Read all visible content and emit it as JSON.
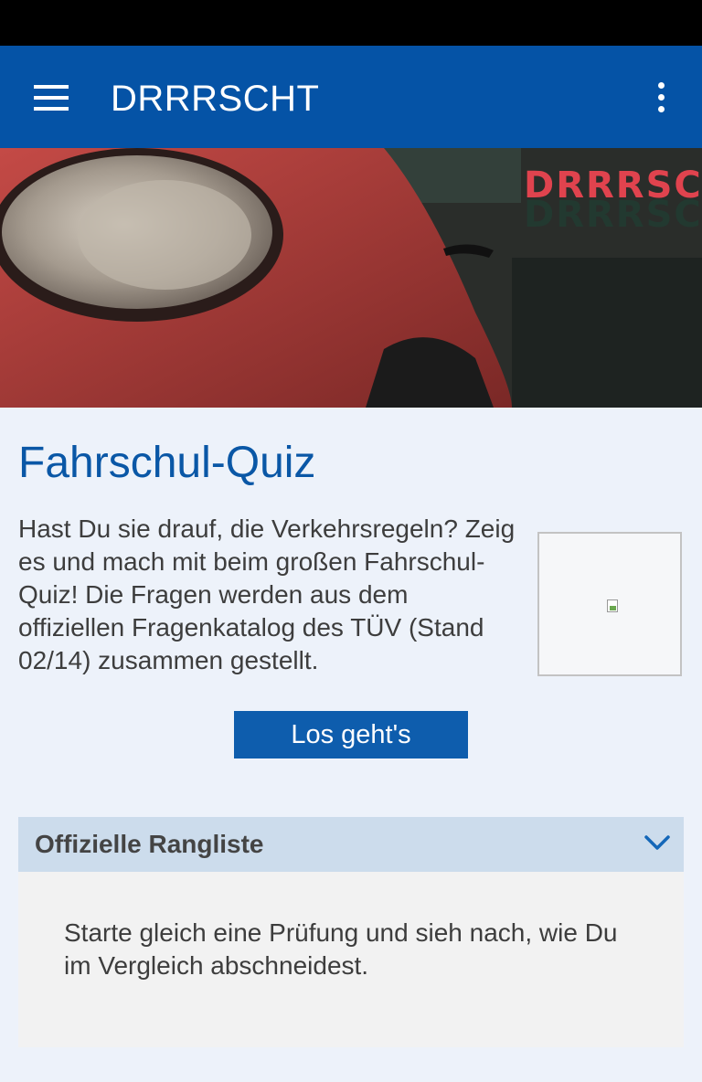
{
  "app_bar": {
    "title": "DRRRSCHT",
    "menu_icon": "hamburger-menu-icon",
    "overflow_icon": "more-vertical-icon",
    "background_color": "#0553a6"
  },
  "hero": {
    "brand_text": "DRRRSCHT"
  },
  "quiz": {
    "title": "Fahrschul-Quiz",
    "description": "Hast Du sie drauf, die Verkehrsregeln? Zeig es und mach mit beim großen Fahrschul-Quiz! Die Fragen werden aus dem offiziellen Fragenkatalog des TÜV (Stand 02/14) zusammen gestellt.",
    "image_icon": "broken-image-icon",
    "button_label": "Los geht's"
  },
  "ranking": {
    "title": "Offizielle Rangliste",
    "toggle_icon": "chevron-down-icon",
    "body": "Starte gleich eine Prüfung und sieh nach, wie Du im Vergleich abschneidest."
  }
}
